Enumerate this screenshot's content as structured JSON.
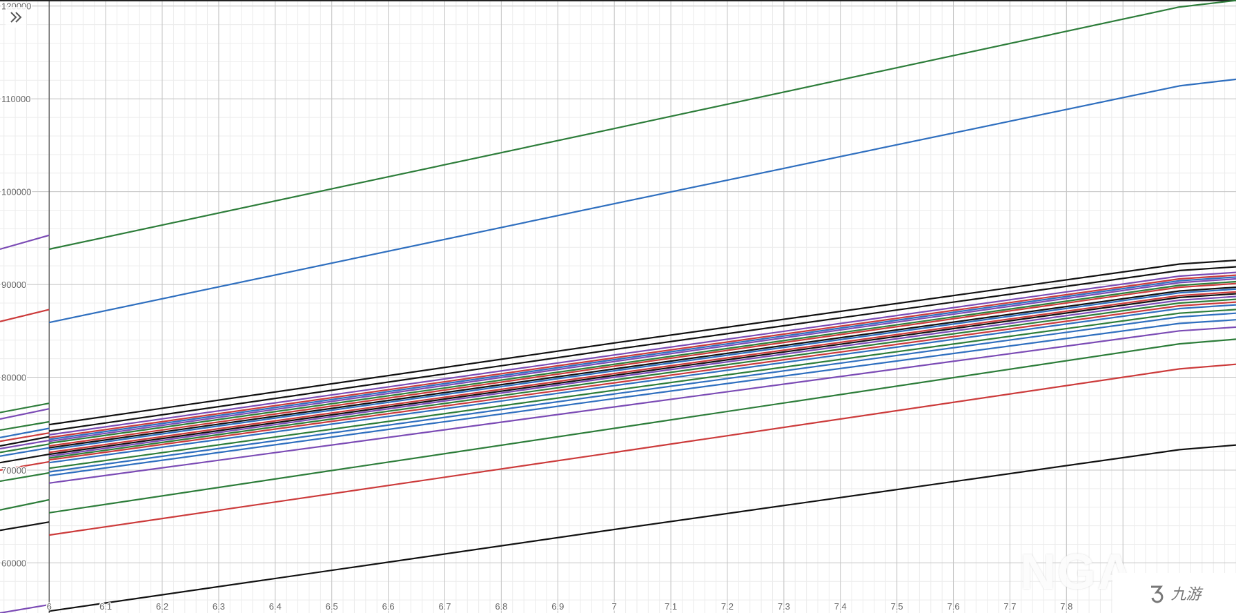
{
  "ui": {
    "expand_icon": "double-chevron-right-icon",
    "watermark_text": "NGA",
    "logo_text": "九游"
  },
  "chart_data": {
    "type": "line",
    "title": "",
    "xlabel": "",
    "ylabel": "",
    "xlim": [
      5.913,
      8.1
    ],
    "ylim": [
      54600,
      120650
    ],
    "x_ticks": [
      6,
      6.1,
      6.2,
      6.3,
      6.4,
      6.5,
      6.6,
      6.7,
      6.8,
      6.9,
      7,
      7.1,
      7.2,
      7.3,
      7.4,
      7.5,
      7.6,
      7.7,
      7.8,
      7.9
    ],
    "x_tick_labels": [
      "6",
      "6.1",
      "6.2",
      "6.3",
      "6.4",
      "6.5",
      "6.6",
      "6.7",
      "6.8",
      "6.9",
      "7",
      "7.1",
      "7.2",
      "7.3",
      "7.4",
      "7.5",
      "7.6",
      "7.7",
      "7.8",
      ""
    ],
    "y_ticks": [
      60000,
      70000,
      80000,
      90000,
      100000,
      110000,
      120000
    ],
    "y_tick_labels": [
      "60000",
      "70000",
      "80000",
      "90000",
      "100000",
      "110000",
      "120000"
    ],
    "grid": true,
    "legend": "none",
    "series": [
      {
        "color": "#2d7d3a",
        "points": [
          [
            6,
            93800
          ],
          [
            7.0,
            106800
          ],
          [
            8.0,
            119900
          ],
          [
            8.1,
            120600
          ]
        ]
      },
      {
        "color": "#2f6fbf",
        "points": [
          [
            6,
            85900
          ],
          [
            7.0,
            98700
          ],
          [
            8.0,
            111400
          ],
          [
            8.1,
            112100
          ]
        ]
      },
      {
        "color": "#111111",
        "points": [
          [
            6,
            74900
          ],
          [
            7.0,
            83700
          ],
          [
            8.0,
            92200
          ],
          [
            8.1,
            92600
          ]
        ]
      },
      {
        "color": "#111111",
        "points": [
          [
            6,
            74200
          ],
          [
            7.0,
            83000
          ],
          [
            8.0,
            91500
          ],
          [
            8.1,
            91900
          ]
        ]
      },
      {
        "color": "#7b4bb5",
        "points": [
          [
            6,
            73800
          ],
          [
            7.0,
            82400
          ],
          [
            8.0,
            90900
          ],
          [
            8.1,
            91300
          ]
        ]
      },
      {
        "color": "#cc3b3b",
        "points": [
          [
            6,
            73500
          ],
          [
            7.0,
            82100
          ],
          [
            8.0,
            90600
          ],
          [
            8.1,
            91000
          ]
        ]
      },
      {
        "color": "#2f6fbf",
        "points": [
          [
            6,
            73300
          ],
          [
            7.0,
            81900
          ],
          [
            8.0,
            90400
          ],
          [
            8.1,
            90800
          ]
        ]
      },
      {
        "color": "#7b4bb5",
        "points": [
          [
            6,
            73100
          ],
          [
            7.0,
            81700
          ],
          [
            8.0,
            90200
          ],
          [
            8.1,
            90600
          ]
        ]
      },
      {
        "color": "#2d7d3a",
        "points": [
          [
            6,
            72900
          ],
          [
            7.0,
            81400
          ],
          [
            8.0,
            89900
          ],
          [
            8.1,
            90300
          ]
        ]
      },
      {
        "color": "#cc3b3b",
        "points": [
          [
            6,
            72600
          ],
          [
            7.0,
            81200
          ],
          [
            8.0,
            89700
          ],
          [
            8.1,
            90100
          ]
        ]
      },
      {
        "color": "#111111",
        "points": [
          [
            6,
            72400
          ],
          [
            7.0,
            80900
          ],
          [
            8.0,
            89300
          ],
          [
            8.1,
            89700
          ]
        ]
      },
      {
        "color": "#2f6fbf",
        "points": [
          [
            6,
            72200
          ],
          [
            7.0,
            80700
          ],
          [
            8.0,
            89100
          ],
          [
            8.1,
            89500
          ]
        ]
      },
      {
        "color": "#cc3b3b",
        "points": [
          [
            6,
            71900
          ],
          [
            7.0,
            80400
          ],
          [
            8.0,
            88800
          ],
          [
            8.1,
            89200
          ]
        ]
      },
      {
        "color": "#111111",
        "points": [
          [
            6,
            71700
          ],
          [
            7.0,
            80200
          ],
          [
            8.0,
            88600
          ],
          [
            8.1,
            89000
          ]
        ]
      },
      {
        "color": "#7b4bb5",
        "points": [
          [
            6,
            71500
          ],
          [
            7.0,
            80000
          ],
          [
            8.0,
            88300
          ],
          [
            8.1,
            88700
          ]
        ]
      },
      {
        "color": "#2d7d3a",
        "points": [
          [
            6,
            71300
          ],
          [
            7.0,
            79700
          ],
          [
            8.0,
            88000
          ],
          [
            8.1,
            88400
          ]
        ]
      },
      {
        "color": "#cc3b3b",
        "points": [
          [
            6,
            71100
          ],
          [
            7.0,
            79400
          ],
          [
            8.0,
            87700
          ],
          [
            8.1,
            88100
          ]
        ]
      },
      {
        "color": "#2f6fbf",
        "points": [
          [
            6,
            70800
          ],
          [
            7.0,
            79100
          ],
          [
            8.0,
            87400
          ],
          [
            8.1,
            87800
          ]
        ]
      },
      {
        "color": "#2d7d3a",
        "points": [
          [
            6,
            70200
          ],
          [
            7.0,
            78600
          ],
          [
            8.0,
            86900
          ],
          [
            8.1,
            87300
          ]
        ]
      },
      {
        "color": "#2f6fbf",
        "points": [
          [
            6,
            69800
          ],
          [
            7.0,
            78200
          ],
          [
            8.0,
            86500
          ],
          [
            8.1,
            86900
          ]
        ]
      },
      {
        "color": "#2f6fbf",
        "points": [
          [
            6,
            69400
          ],
          [
            7.0,
            77700
          ],
          [
            8.0,
            85800
          ],
          [
            8.1,
            86200
          ]
        ]
      },
      {
        "color": "#7b4bb5",
        "points": [
          [
            6,
            68600
          ],
          [
            7.0,
            76800
          ],
          [
            8.0,
            85000
          ],
          [
            8.1,
            85400
          ]
        ]
      },
      {
        "color": "#2d7d3a",
        "points": [
          [
            6,
            65400
          ],
          [
            7.0,
            74500
          ],
          [
            8.0,
            83600
          ],
          [
            8.1,
            84100
          ]
        ]
      },
      {
        "color": "#cc3b3b",
        "points": [
          [
            6,
            63000
          ],
          [
            7.0,
            71900
          ],
          [
            8.0,
            80900
          ],
          [
            8.1,
            81400
          ]
        ]
      },
      {
        "color": "#111111",
        "points": [
          [
            6,
            54800
          ],
          [
            7.0,
            63600
          ],
          [
            8.0,
            72200
          ],
          [
            8.1,
            72700
          ]
        ]
      },
      {
        "color": "#7b4bb5",
        "points": [
          [
            5.913,
            93800
          ],
          [
            6,
            95300
          ]
        ]
      },
      {
        "color": "#cc3b3b",
        "points": [
          [
            5.913,
            86000
          ],
          [
            6,
            87300
          ]
        ]
      },
      {
        "color": "#2d7d3a",
        "points": [
          [
            5.913,
            76200
          ],
          [
            6,
            77200
          ]
        ]
      },
      {
        "color": "#7b4bb5",
        "points": [
          [
            5.913,
            75500
          ],
          [
            6,
            76600
          ]
        ]
      },
      {
        "color": "#2d7d3a",
        "points": [
          [
            5.913,
            74300
          ],
          [
            6,
            75200
          ]
        ]
      },
      {
        "color": "#2f6fbf",
        "points": [
          [
            5.913,
            73500
          ],
          [
            6,
            74500
          ]
        ]
      },
      {
        "color": "#cc3b3b",
        "points": [
          [
            5.913,
            73100
          ],
          [
            6,
            74000
          ]
        ]
      },
      {
        "color": "#111111",
        "points": [
          [
            5.913,
            72600
          ],
          [
            6,
            73600
          ]
        ]
      },
      {
        "color": "#7b4bb5",
        "points": [
          [
            5.913,
            72300
          ],
          [
            6,
            73200
          ]
        ]
      },
      {
        "color": "#2d7d3a",
        "points": [
          [
            5.913,
            71900
          ],
          [
            6,
            72800
          ]
        ]
      },
      {
        "color": "#2f6fbf",
        "points": [
          [
            5.913,
            71500
          ],
          [
            6,
            72400
          ]
        ]
      },
      {
        "color": "#111111",
        "points": [
          [
            5.913,
            70800
          ],
          [
            6,
            71700
          ]
        ]
      },
      {
        "color": "#cc3b3b",
        "points": [
          [
            5.913,
            70000
          ],
          [
            6,
            70900
          ]
        ]
      },
      {
        "color": "#2d7d3a",
        "points": [
          [
            5.913,
            68800
          ],
          [
            6,
            69700
          ]
        ]
      },
      {
        "color": "#2d7d3a",
        "points": [
          [
            5.913,
            65700
          ],
          [
            6,
            66800
          ]
        ]
      },
      {
        "color": "#111111",
        "points": [
          [
            5.913,
            63500
          ],
          [
            6,
            64400
          ]
        ]
      },
      {
        "color": "#7b4bb5",
        "points": [
          [
            5.913,
            54600
          ],
          [
            6,
            55500
          ]
        ]
      }
    ]
  }
}
